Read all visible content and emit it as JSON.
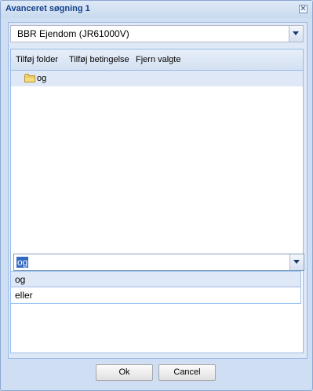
{
  "dialog": {
    "title": "Avanceret søgning 1",
    "close_icon": "close-icon"
  },
  "layer_select": {
    "value": "BBR Ejendom (JR61000V)"
  },
  "toolbar": {
    "add_folder": "Tilføj folder",
    "add_condition": "Tilføj betingelse",
    "remove_selected": "Fjern valgte"
  },
  "tree": {
    "items": [
      {
        "label": "og",
        "icon": "folder-icon"
      }
    ]
  },
  "operator_select": {
    "value": "og",
    "options": [
      "og",
      "eller"
    ]
  },
  "footer": {
    "ok_label": "Ok",
    "cancel_label": "Cancel"
  }
}
